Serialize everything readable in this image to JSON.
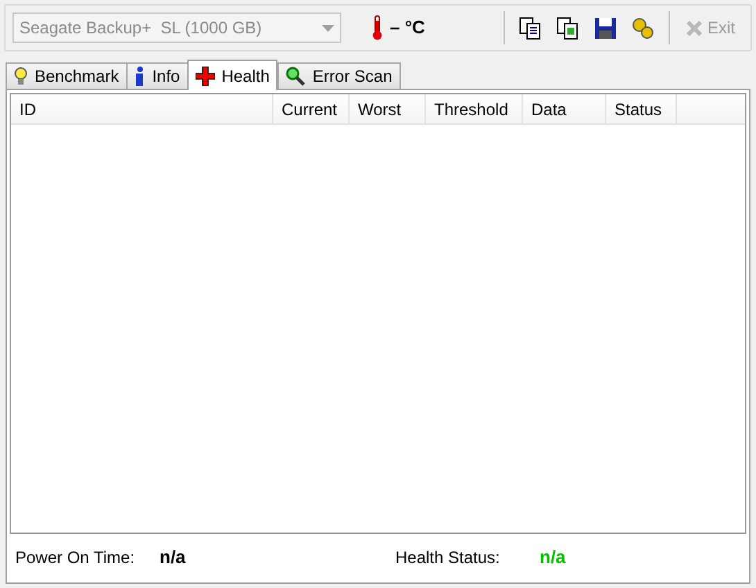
{
  "device_select": {
    "value": "Seagate Backup+  SL (1000 GB)",
    "disabled": true
  },
  "temperature": "– °C",
  "exit_button": {
    "label": "Exit",
    "disabled": true
  },
  "tabs": [
    {
      "label": "Benchmark",
      "selected": false
    },
    {
      "label": "Info",
      "selected": false
    },
    {
      "label": "Health",
      "selected": true
    },
    {
      "label": "Error Scan",
      "selected": false
    }
  ],
  "table": {
    "columns": [
      "ID",
      "Current",
      "Worst",
      "Threshold",
      "Data",
      "Status"
    ]
  },
  "footer": [
    {
      "label": "Power On Time:",
      "value": "n/a",
      "color": "#000000"
    },
    {
      "label": "Health Status:",
      "value": "n/a",
      "color": "#00c000"
    }
  ]
}
